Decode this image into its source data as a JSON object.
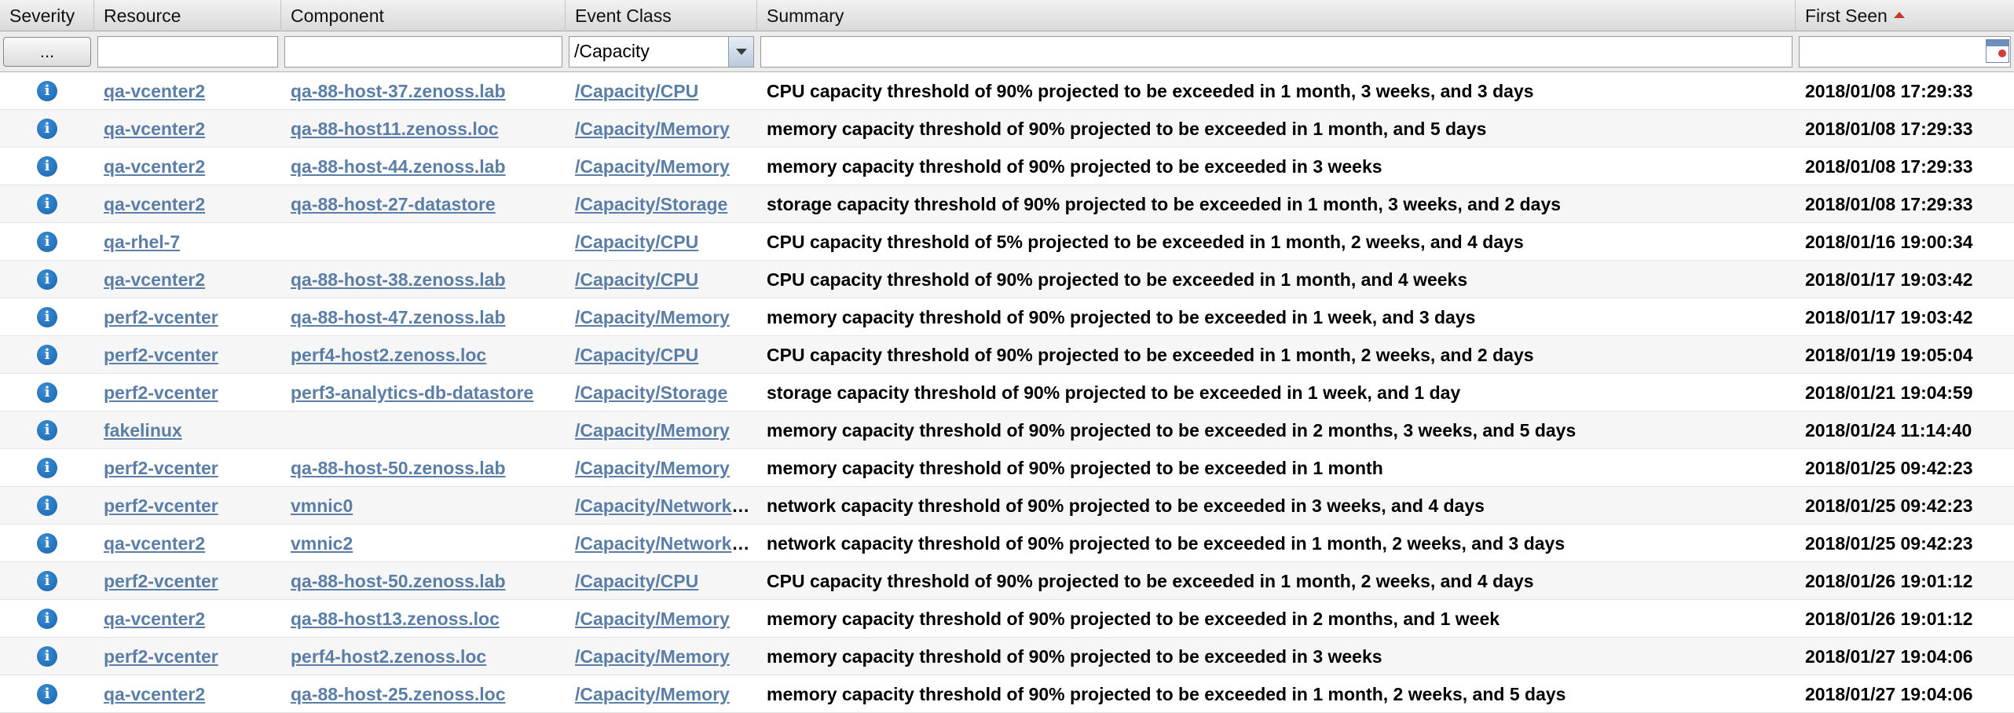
{
  "columns": {
    "severity": "Severity",
    "resource": "Resource",
    "component": "Component",
    "event_class": "Event Class",
    "summary": "Summary",
    "first_seen": "First Seen"
  },
  "sort": {
    "column": "first_seen",
    "direction": "ascending"
  },
  "filters": {
    "severity_button": "...",
    "resource": "",
    "component": "",
    "event_class": "/Capacity",
    "summary": "",
    "first_seen": ""
  },
  "icons": {
    "severity": "info-icon",
    "sort": "sort-ascending-icon",
    "calendar": "calendar-icon",
    "dropdown": "chevron-down-icon"
  },
  "colors": {
    "link": "#5b7ea6",
    "info": "#1563ad",
    "sort_arrow": "#c0392b"
  },
  "rows": [
    {
      "severity": "info",
      "resource": "qa-vcenter2",
      "component": "qa-88-host-37.zenoss.lab",
      "event_class": "/Capacity/CPU",
      "summary": "CPU capacity threshold of 90% projected to be exceeded in 1 month, 3 weeks, and 3 days",
      "first_seen": "2018/01/08 17:29:33"
    },
    {
      "severity": "info",
      "resource": "qa-vcenter2",
      "component": "qa-88-host11.zenoss.loc",
      "event_class": "/Capacity/Memory",
      "summary": "memory capacity threshold of 90% projected to be exceeded in 1 month, and 5 days",
      "first_seen": "2018/01/08 17:29:33"
    },
    {
      "severity": "info",
      "resource": "qa-vcenter2",
      "component": "qa-88-host-44.zenoss.lab",
      "event_class": "/Capacity/Memory",
      "summary": "memory capacity threshold of 90% projected to be exceeded in 3 weeks",
      "first_seen": "2018/01/08 17:29:33"
    },
    {
      "severity": "info",
      "resource": "qa-vcenter2",
      "component": "qa-88-host-27-datastore",
      "event_class": "/Capacity/Storage",
      "summary": "storage capacity threshold of 90% projected to be exceeded in 1 month, 3 weeks, and 2 days",
      "first_seen": "2018/01/08 17:29:33"
    },
    {
      "severity": "info",
      "resource": "qa-rhel-7",
      "component": "",
      "event_class": "/Capacity/CPU",
      "summary": "CPU capacity threshold of 5% projected to be exceeded in 1 month, 2 weeks, and 4 days",
      "first_seen": "2018/01/16 19:00:34"
    },
    {
      "severity": "info",
      "resource": "qa-vcenter2",
      "component": "qa-88-host-38.zenoss.lab",
      "event_class": "/Capacity/CPU",
      "summary": "CPU capacity threshold of 90% projected to be exceeded in 1 month, and 4 weeks",
      "first_seen": "2018/01/17 19:03:42"
    },
    {
      "severity": "info",
      "resource": "perf2-vcenter",
      "component": "qa-88-host-47.zenoss.lab",
      "event_class": "/Capacity/Memory",
      "summary": "memory capacity threshold of 90% projected to be exceeded in 1 week, and 3 days",
      "first_seen": "2018/01/17 19:03:42"
    },
    {
      "severity": "info",
      "resource": "perf2-vcenter",
      "component": "perf4-host2.zenoss.loc",
      "event_class": "/Capacity/CPU",
      "summary": "CPU capacity threshold of 90% projected to be exceeded in 1 month, 2 weeks, and 2 days",
      "first_seen": "2018/01/19 19:05:04"
    },
    {
      "severity": "info",
      "resource": "perf2-vcenter",
      "component": "perf3-analytics-db-datastore",
      "event_class": "/Capacity/Storage",
      "summary": "storage capacity threshold of 90% projected to be exceeded in 1 week, and 1 day",
      "first_seen": "2018/01/21 19:04:59"
    },
    {
      "severity": "info",
      "resource": "fakelinux",
      "component": "",
      "event_class": "/Capacity/Memory",
      "summary": "memory capacity threshold of 90% projected to be exceeded in 2 months, 3 weeks, and 5 days",
      "first_seen": "2018/01/24 11:14:40"
    },
    {
      "severity": "info",
      "resource": "perf2-vcenter",
      "component": "qa-88-host-50.zenoss.lab",
      "event_class": "/Capacity/Memory",
      "summary": "memory capacity threshold of 90% projected to be exceeded in 1 month",
      "first_seen": "2018/01/25 09:42:23"
    },
    {
      "severity": "info",
      "resource": "perf2-vcenter",
      "component": "vmnic0",
      "event_class": "/Capacity/Network ...",
      "summary": "network capacity threshold of 90% projected to be exceeded in 3 weeks, and 4 days",
      "first_seen": "2018/01/25 09:42:23"
    },
    {
      "severity": "info",
      "resource": "qa-vcenter2",
      "component": "vmnic2",
      "event_class": "/Capacity/Network ...",
      "summary": "network capacity threshold of 90% projected to be exceeded in 1 month, 2 weeks, and 3 days",
      "first_seen": "2018/01/25 09:42:23"
    },
    {
      "severity": "info",
      "resource": "perf2-vcenter",
      "component": "qa-88-host-50.zenoss.lab",
      "event_class": "/Capacity/CPU",
      "summary": "CPU capacity threshold of 90% projected to be exceeded in 1 month, 2 weeks, and 4 days",
      "first_seen": "2018/01/26 19:01:12"
    },
    {
      "severity": "info",
      "resource": "qa-vcenter2",
      "component": "qa-88-host13.zenoss.loc",
      "event_class": "/Capacity/Memory",
      "summary": "memory capacity threshold of 90% projected to be exceeded in 2 months, and 1 week",
      "first_seen": "2018/01/26 19:01:12"
    },
    {
      "severity": "info",
      "resource": "perf2-vcenter",
      "component": "perf4-host2.zenoss.loc",
      "event_class": "/Capacity/Memory",
      "summary": "memory capacity threshold of 90% projected to be exceeded in 3 weeks",
      "first_seen": "2018/01/27 19:04:06"
    },
    {
      "severity": "info",
      "resource": "qa-vcenter2",
      "component": "qa-88-host-25.zenoss.loc",
      "event_class": "/Capacity/Memory",
      "summary": "memory capacity threshold of 90% projected to be exceeded in 1 month, 2 weeks, and 5 days",
      "first_seen": "2018/01/27 19:04:06"
    }
  ]
}
